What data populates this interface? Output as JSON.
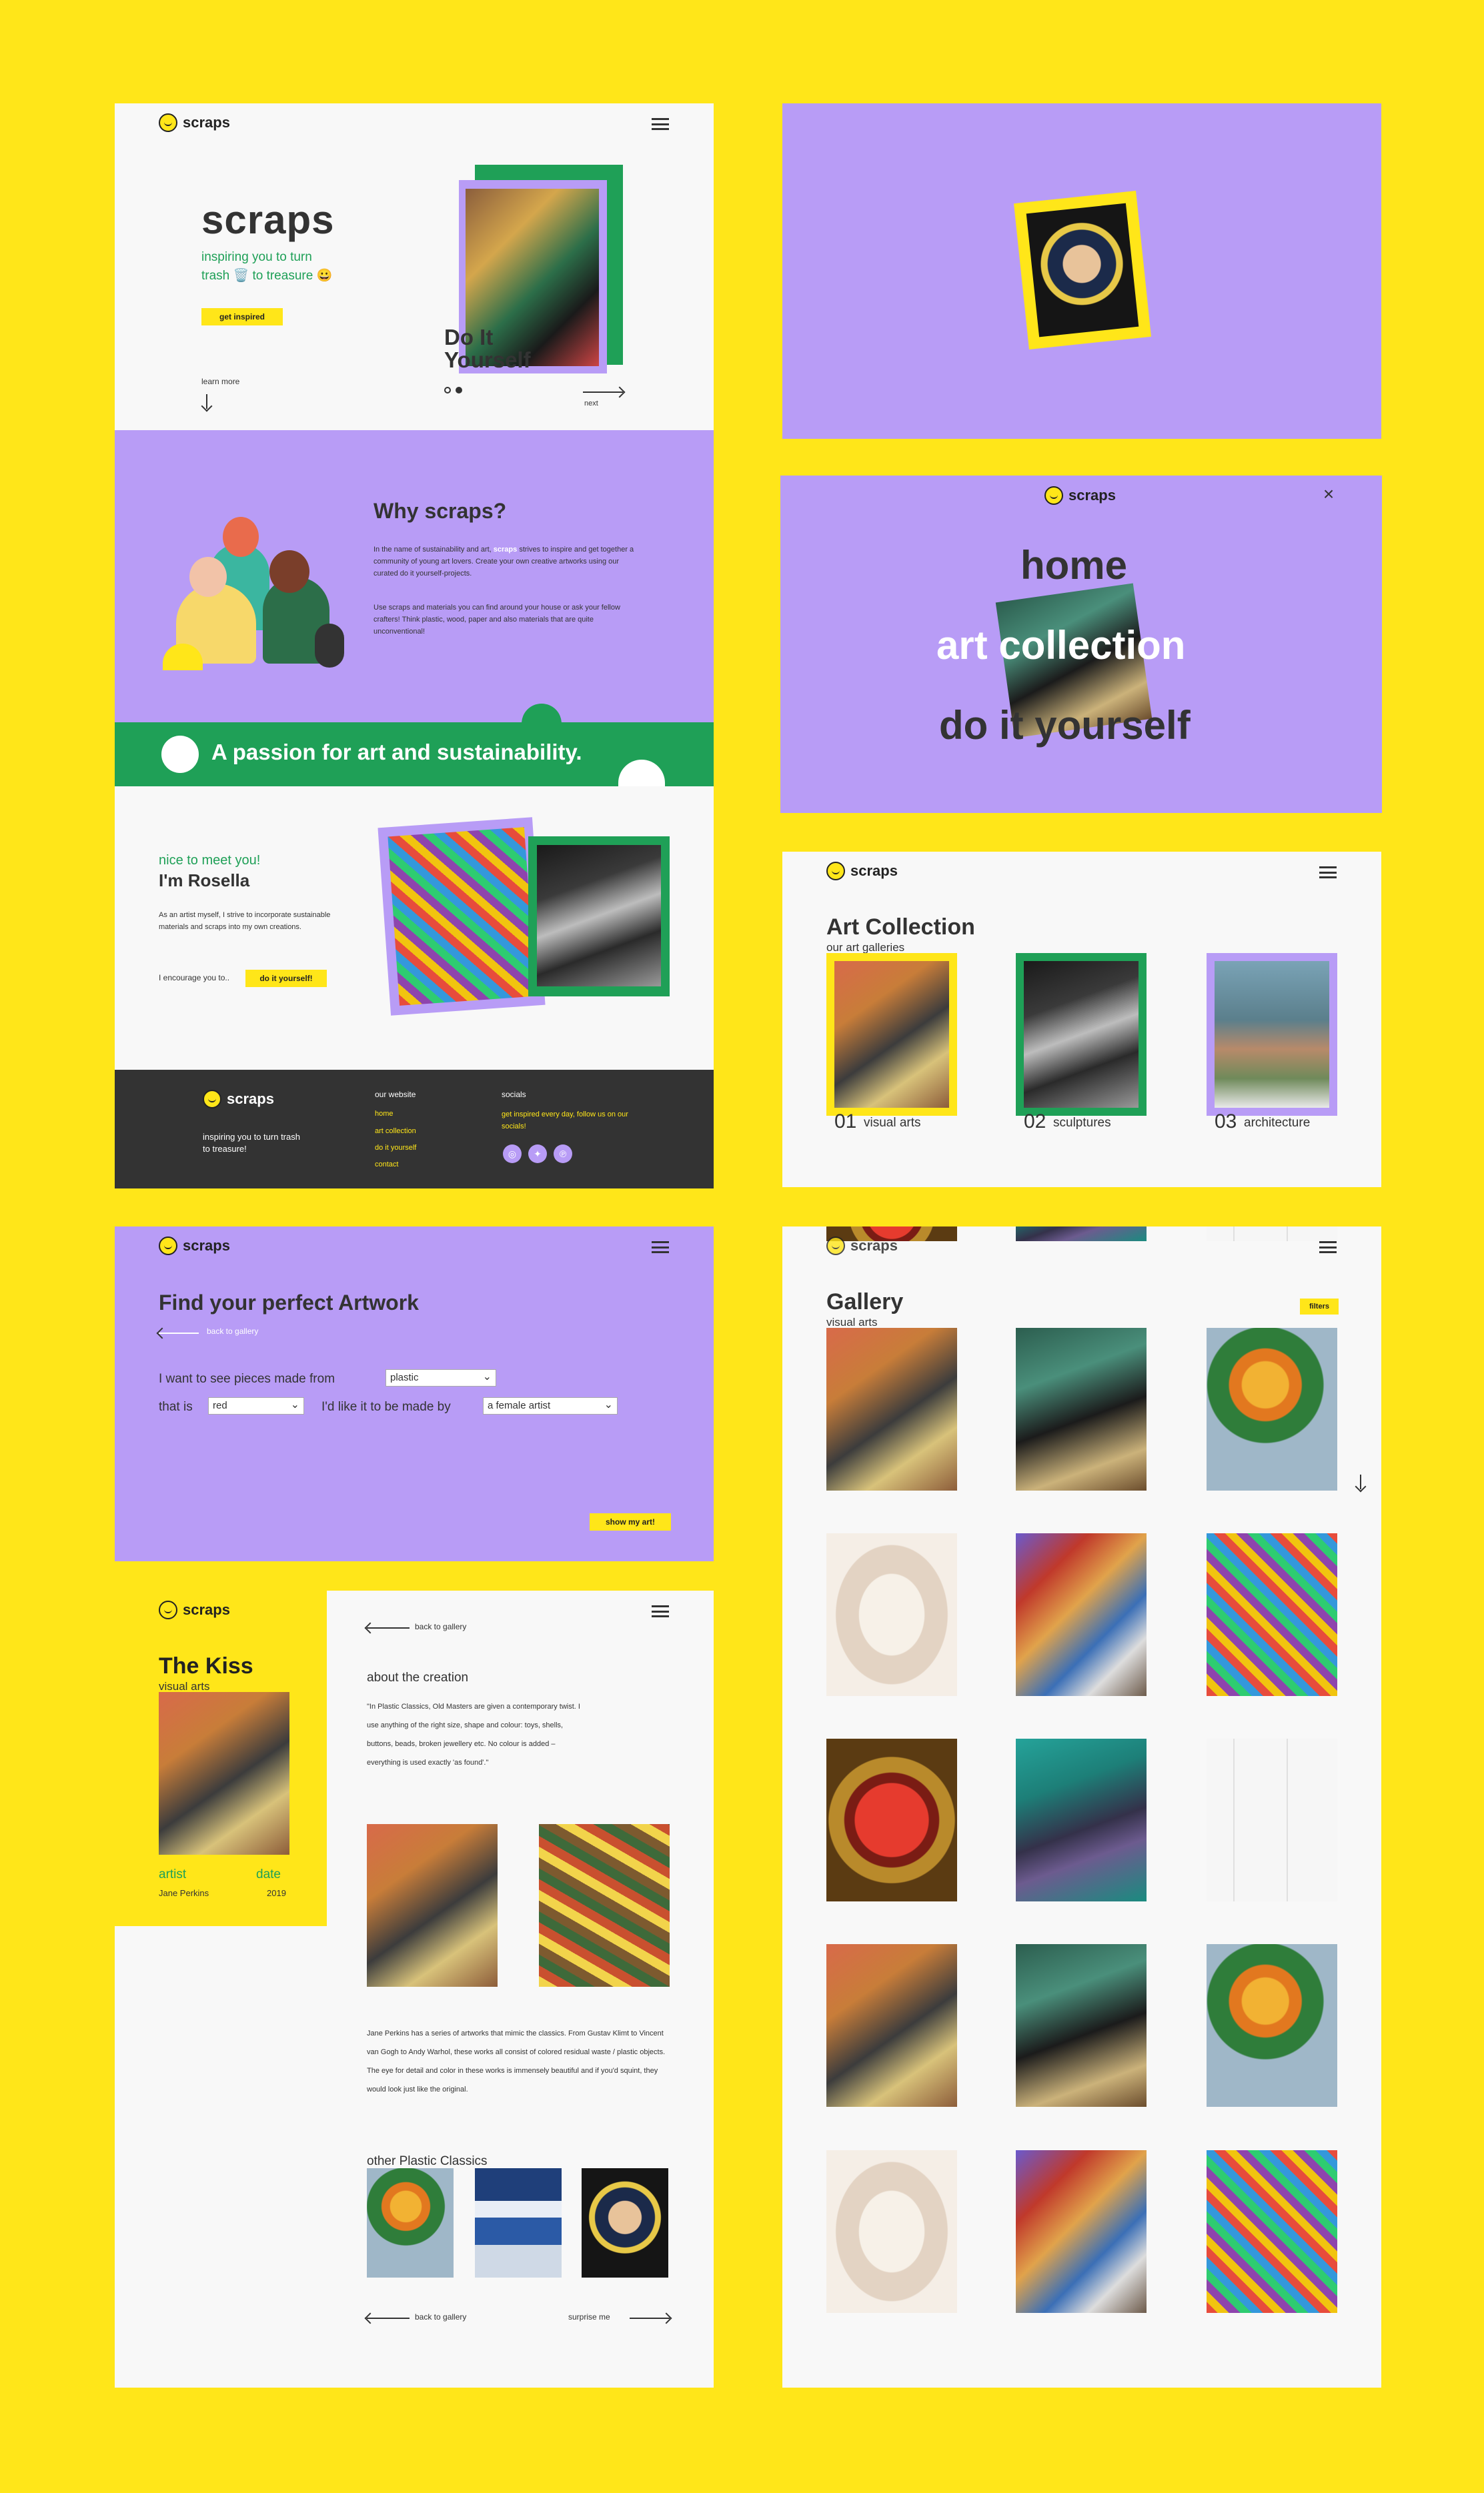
{
  "brand": {
    "name": "scraps",
    "accent": "#FFE619",
    "purple": "#B89CF6",
    "green": "#1FA057",
    "dark": "#333333"
  },
  "home": {
    "title": "scraps",
    "tagline_1": "inspiring you to turn",
    "tagline_2": "trash 🗑️ to treasure 😀",
    "cta": "get inspired",
    "learn_more": "learn more",
    "slide_caption_1": "Do It",
    "slide_caption_2": "Yourself",
    "next": "next"
  },
  "why": {
    "heading": "Why scraps?",
    "p1_a": "In the name of sustainability and art,",
    "p1_brand": "scraps",
    "p1_b": "strives to inspire and get together a community of young art lovers. Create your own creative artworks using our curated do it yourself-projects.",
    "p2": "Use scraps and materials you can find around your house or ask your fellow crafters! Think plastic, wood, paper and also materials that are quite unconventional!"
  },
  "banner": {
    "text": "A passion for art and sustainability."
  },
  "about": {
    "greeting": "nice to meet you!",
    "name": "I'm Rosella",
    "p1": "As an artist myself, I strive to incorporate sustainable materials and scraps into my own creations.",
    "encourage": "I encourage you to..",
    "cta": "do it yourself!"
  },
  "footer": {
    "tagline": "inspiring you to turn trash to treasure!",
    "site_heading": "our website",
    "links": [
      "home",
      "art collection",
      "do it yourself",
      "contact"
    ],
    "social_heading": "socials",
    "social_text": "get inspired every day, follow us on our socials!"
  },
  "menu": {
    "items": [
      "home",
      "art collection",
      "do it yourself"
    ]
  },
  "collection": {
    "title": "Art Collection",
    "subtitle": "our art galleries",
    "items": [
      {
        "num": "01",
        "label": "visual arts"
      },
      {
        "num": "02",
        "label": "sculptures"
      },
      {
        "num": "03",
        "label": "architecture"
      }
    ]
  },
  "finder": {
    "title": "Find your perfect Artwork",
    "back": "back to gallery",
    "line1": "I want to see pieces made from",
    "line2a": "that is",
    "line2b": "I'd like it to be made by",
    "material": "plastic",
    "color": "red",
    "maker": "a female artist",
    "cta": "show my art!"
  },
  "detail": {
    "title": "The Kiss",
    "category": "visual arts",
    "artist_label": "artist",
    "date_label": "date",
    "artist": "Jane Perkins",
    "date": "2019",
    "back": "back to gallery",
    "about_heading": "about the creation",
    "quote": "\"In Plastic Classics, Old Masters are given a contemporary twist. I use anything of the right size, shape and colour: toys, shells, buttons, beads, broken jewellery etc. No colour is added – everything is used exactly 'as found'.\"",
    "body": "Jane Perkins has a series of artworks that mimic the classics. From Gustav Klimt to Vincent van Gogh to Andy Warhol, these works all consist of colored residual waste / plastic objects. The eye for detail and color in these works is immensely beautiful and if you'd squint, they would look just like the original.",
    "other_heading": "other Plastic Classics",
    "back2": "back to gallery",
    "surprise": "surprise me"
  },
  "gallery": {
    "title": "Gallery",
    "subtitle": "visual arts",
    "filters": "filters"
  }
}
